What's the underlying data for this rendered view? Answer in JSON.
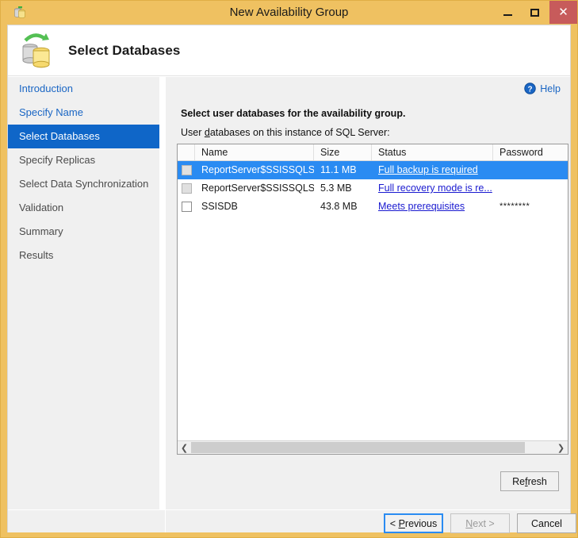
{
  "window": {
    "title": "New Availability Group",
    "app_icon": "database-wizard-icon",
    "controls": {
      "minimize": "minimize-icon",
      "maximize": "maximize-icon",
      "close": "close-icon"
    }
  },
  "header": {
    "icon": "availability-group-databases-icon",
    "title": "Select Databases"
  },
  "sidebar": {
    "items": [
      {
        "label": "Introduction",
        "state": "link"
      },
      {
        "label": "Specify Name",
        "state": "link"
      },
      {
        "label": "Select Databases",
        "state": "active"
      },
      {
        "label": "Specify Replicas",
        "state": "pending"
      },
      {
        "label": "Select Data Synchronization",
        "state": "pending"
      },
      {
        "label": "Validation",
        "state": "pending"
      },
      {
        "label": "Summary",
        "state": "pending"
      },
      {
        "label": "Results",
        "state": "pending"
      }
    ]
  },
  "main": {
    "help": {
      "label": "Help",
      "icon": "help-circle-icon"
    },
    "instruction": "Select user databases for the availability group.",
    "sub_label_before": "User ",
    "sub_label_mnemonic": "d",
    "sub_label_after": "atabases on this instance of SQL Server:",
    "table": {
      "columns": [
        "",
        "Name",
        "Size",
        "Status",
        "Password"
      ],
      "rows": [
        {
          "checked": false,
          "checkbox_state": "disabled",
          "name": "ReportServer$SSISSQLSER...",
          "size": "11.1 MB",
          "status": "Full backup is required",
          "password": "",
          "selected": true
        },
        {
          "checked": false,
          "checkbox_state": "disabled",
          "name": "ReportServer$SSISSQLSER...",
          "size": "5.3 MB",
          "status": "Full recovery mode is re...",
          "password": "",
          "selected": false
        },
        {
          "checked": false,
          "checkbox_state": "enabled",
          "name": "SSISDB",
          "size": "43.8 MB",
          "status": "Meets prerequisites",
          "password": "********",
          "selected": false
        }
      ]
    },
    "scrollbar": {
      "left_arrow": "chevron-left-icon",
      "right_arrow": "chevron-right-icon"
    },
    "refresh": {
      "before": "Re",
      "mnemonic": "f",
      "after": "resh"
    }
  },
  "footer": {
    "previous": {
      "before": "< ",
      "mnemonic": "P",
      "after": "revious",
      "enabled": true
    },
    "next": {
      "before": "",
      "mnemonic": "N",
      "after": "ext >",
      "enabled": false
    },
    "cancel": {
      "before": "Cancel",
      "mnemonic": "",
      "after": "",
      "enabled": true
    }
  },
  "colors": {
    "window_frame": "#efc161",
    "close_button": "#c75b5b",
    "sidebar_active": "#0f66c8",
    "row_selected": "#2a8bf2",
    "link": "#1a66c4",
    "status_link": "#1a1ad0"
  }
}
